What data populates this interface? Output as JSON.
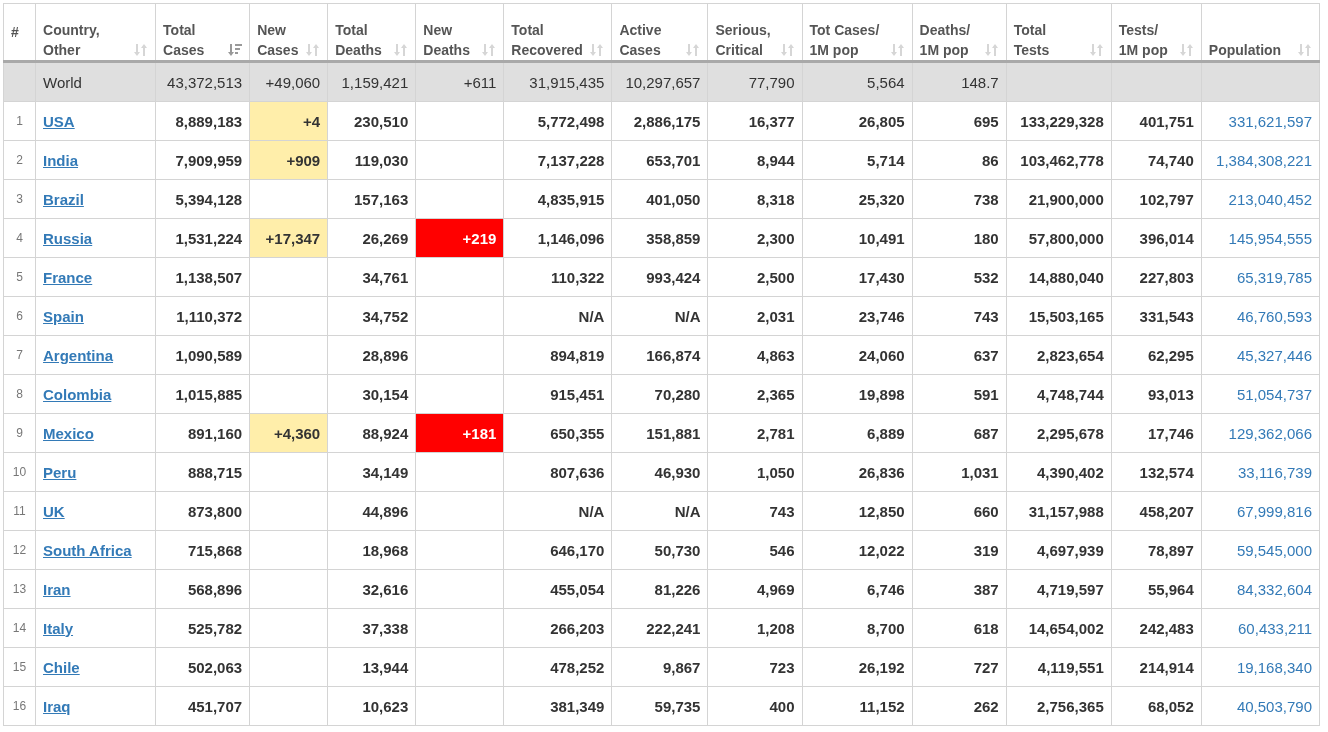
{
  "table": {
    "columns": [
      {
        "label": "#"
      },
      {
        "label": "Country,\nOther",
        "sorted": false
      },
      {
        "label": "Total\nCases",
        "sorted": true
      },
      {
        "label": "New\nCases",
        "sorted": false
      },
      {
        "label": "Total\nDeaths",
        "sorted": false
      },
      {
        "label": "New\nDeaths",
        "sorted": false
      },
      {
        "label": "Total\nRecovered",
        "sorted": false
      },
      {
        "label": "Active\nCases",
        "sorted": false
      },
      {
        "label": "Serious,\nCritical",
        "sorted": false
      },
      {
        "label": "Tot Cases/\n1M pop",
        "sorted": false
      },
      {
        "label": "Deaths/\n1M pop",
        "sorted": false
      },
      {
        "label": "Total\nTests",
        "sorted": false
      },
      {
        "label": "Tests/\n1M pop",
        "sorted": false
      },
      {
        "label": "Population",
        "sorted": false
      }
    ],
    "total_row": {
      "country": "World",
      "total_cases": "43,372,513",
      "new_cases": "+49,060",
      "total_deaths": "1,159,421",
      "new_deaths": "+611",
      "total_recovered": "31,915,435",
      "active_cases": "10,297,657",
      "serious_critical": "77,790",
      "cases_per_1m": "5,564",
      "deaths_per_1m": "148.7"
    },
    "rows": [
      {
        "rank": "1",
        "country": "USA",
        "total_cases": "8,889,183",
        "new_cases": "+4",
        "total_deaths": "230,510",
        "total_recovered": "5,772,498",
        "active_cases": "2,886,175",
        "serious_critical": "16,377",
        "cases_per_1m": "26,805",
        "deaths_per_1m": "695",
        "total_tests": "133,229,328",
        "tests_per_1m": "401,751",
        "population": "331,621,597"
      },
      {
        "rank": "2",
        "country": "India",
        "total_cases": "7,909,959",
        "new_cases": "+909",
        "total_deaths": "119,030",
        "total_recovered": "7,137,228",
        "active_cases": "653,701",
        "serious_critical": "8,944",
        "cases_per_1m": "5,714",
        "deaths_per_1m": "86",
        "total_tests": "103,462,778",
        "tests_per_1m": "74,740",
        "population": "1,384,308,221"
      },
      {
        "rank": "3",
        "country": "Brazil",
        "total_cases": "5,394,128",
        "total_deaths": "157,163",
        "total_recovered": "4,835,915",
        "active_cases": "401,050",
        "serious_critical": "8,318",
        "cases_per_1m": "25,320",
        "deaths_per_1m": "738",
        "total_tests": "21,900,000",
        "tests_per_1m": "102,797",
        "population": "213,040,452"
      },
      {
        "rank": "4",
        "country": "Russia",
        "total_cases": "1,531,224",
        "new_cases": "+17,347",
        "total_deaths": "26,269",
        "new_deaths": "+219",
        "total_recovered": "1,146,096",
        "active_cases": "358,859",
        "serious_critical": "2,300",
        "cases_per_1m": "10,491",
        "deaths_per_1m": "180",
        "total_tests": "57,800,000",
        "tests_per_1m": "396,014",
        "population": "145,954,555"
      },
      {
        "rank": "5",
        "country": "France",
        "total_cases": "1,138,507",
        "total_deaths": "34,761",
        "total_recovered": "110,322",
        "active_cases": "993,424",
        "serious_critical": "2,500",
        "cases_per_1m": "17,430",
        "deaths_per_1m": "532",
        "total_tests": "14,880,040",
        "tests_per_1m": "227,803",
        "population": "65,319,785"
      },
      {
        "rank": "6",
        "country": "Spain",
        "total_cases": "1,110,372",
        "total_deaths": "34,752",
        "total_recovered": "N/A",
        "active_cases": "N/A",
        "serious_critical": "2,031",
        "cases_per_1m": "23,746",
        "deaths_per_1m": "743",
        "total_tests": "15,503,165",
        "tests_per_1m": "331,543",
        "population": "46,760,593"
      },
      {
        "rank": "7",
        "country": "Argentina",
        "total_cases": "1,090,589",
        "total_deaths": "28,896",
        "total_recovered": "894,819",
        "active_cases": "166,874",
        "serious_critical": "4,863",
        "cases_per_1m": "24,060",
        "deaths_per_1m": "637",
        "total_tests": "2,823,654",
        "tests_per_1m": "62,295",
        "population": "45,327,446"
      },
      {
        "rank": "8",
        "country": "Colombia",
        "total_cases": "1,015,885",
        "total_deaths": "30,154",
        "total_recovered": "915,451",
        "active_cases": "70,280",
        "serious_critical": "2,365",
        "cases_per_1m": "19,898",
        "deaths_per_1m": "591",
        "total_tests": "4,748,744",
        "tests_per_1m": "93,013",
        "population": "51,054,737"
      },
      {
        "rank": "9",
        "country": "Mexico",
        "total_cases": "891,160",
        "new_cases": "+4,360",
        "total_deaths": "88,924",
        "new_deaths": "+181",
        "total_recovered": "650,355",
        "active_cases": "151,881",
        "serious_critical": "2,781",
        "cases_per_1m": "6,889",
        "deaths_per_1m": "687",
        "total_tests": "2,295,678",
        "tests_per_1m": "17,746",
        "population": "129,362,066"
      },
      {
        "rank": "10",
        "country": "Peru",
        "total_cases": "888,715",
        "total_deaths": "34,149",
        "total_recovered": "807,636",
        "active_cases": "46,930",
        "serious_critical": "1,050",
        "cases_per_1m": "26,836",
        "deaths_per_1m": "1,031",
        "total_tests": "4,390,402",
        "tests_per_1m": "132,574",
        "population": "33,116,739"
      },
      {
        "rank": "11",
        "country": "UK",
        "total_cases": "873,800",
        "total_deaths": "44,896",
        "total_recovered": "N/A",
        "active_cases": "N/A",
        "serious_critical": "743",
        "cases_per_1m": "12,850",
        "deaths_per_1m": "660",
        "total_tests": "31,157,988",
        "tests_per_1m": "458,207",
        "population": "67,999,816"
      },
      {
        "rank": "12",
        "country": "South Africa",
        "total_cases": "715,868",
        "total_deaths": "18,968",
        "total_recovered": "646,170",
        "active_cases": "50,730",
        "serious_critical": "546",
        "cases_per_1m": "12,022",
        "deaths_per_1m": "319",
        "total_tests": "4,697,939",
        "tests_per_1m": "78,897",
        "population": "59,545,000"
      },
      {
        "rank": "13",
        "country": "Iran",
        "total_cases": "568,896",
        "total_deaths": "32,616",
        "total_recovered": "455,054",
        "active_cases": "81,226",
        "serious_critical": "4,969",
        "cases_per_1m": "6,746",
        "deaths_per_1m": "387",
        "total_tests": "4,719,597",
        "tests_per_1m": "55,964",
        "population": "84,332,604"
      },
      {
        "rank": "14",
        "country": "Italy",
        "total_cases": "525,782",
        "total_deaths": "37,338",
        "total_recovered": "266,203",
        "active_cases": "222,241",
        "serious_critical": "1,208",
        "cases_per_1m": "8,700",
        "deaths_per_1m": "618",
        "total_tests": "14,654,002",
        "tests_per_1m": "242,483",
        "population": "60,433,211"
      },
      {
        "rank": "15",
        "country": "Chile",
        "total_cases": "502,063",
        "total_deaths": "13,944",
        "total_recovered": "478,252",
        "active_cases": "9,867",
        "serious_critical": "723",
        "cases_per_1m": "26,192",
        "deaths_per_1m": "727",
        "total_tests": "4,119,551",
        "tests_per_1m": "214,914",
        "population": "19,168,340"
      },
      {
        "rank": "16",
        "country": "Iraq",
        "total_cases": "451,707",
        "total_deaths": "10,623",
        "total_recovered": "381,349",
        "active_cases": "59,735",
        "serious_critical": "400",
        "cases_per_1m": "11,152",
        "deaths_per_1m": "262",
        "total_tests": "2,756,365",
        "tests_per_1m": "68,052",
        "population": "40,503,790"
      }
    ]
  }
}
